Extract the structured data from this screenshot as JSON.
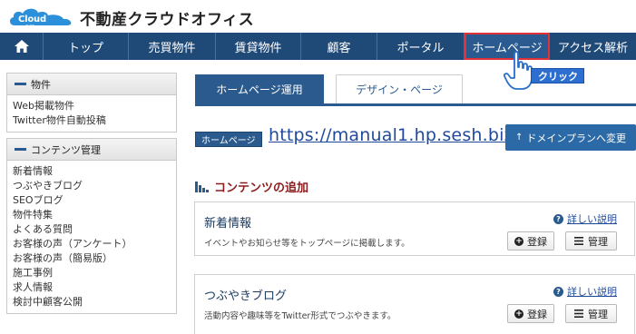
{
  "header": {
    "logo_text": "Cloud office",
    "site_name": "不動産クラウドオフィス"
  },
  "nav": {
    "items": [
      {
        "label": "トップ"
      },
      {
        "label": "売買物件"
      },
      {
        "label": "賃貸物件"
      },
      {
        "label": "顧客"
      },
      {
        "label": "ポータル"
      },
      {
        "label": "ホームページ"
      },
      {
        "label": "アクセス解析"
      }
    ],
    "active": "ホームページ"
  },
  "sidebar": {
    "sections": [
      {
        "title": "物件",
        "links": [
          "Web掲載物件",
          "Twitter物件自動投稿"
        ]
      },
      {
        "title": "コンテンツ管理",
        "links": [
          "新着情報",
          "つぶやきブログ",
          "SEOブログ",
          "物件特集",
          "よくある質問",
          "お客様の声（アンケート）",
          "お客様の声（簡易版）",
          "施工事例",
          "求人情報",
          "検討中顧客公開"
        ]
      }
    ]
  },
  "tabs": [
    {
      "label": "ホームページ運用",
      "active": true
    },
    {
      "label": "デザイン・ページ",
      "active": false
    }
  ],
  "homepage": {
    "badge": "ホームページ",
    "url": "https://manual1.hp.sesh.biz/",
    "domain_button": "ドメインプランへ変更"
  },
  "section_title": "コンテンツの追加",
  "cards": [
    {
      "title": "新着情報",
      "description": "イベントやお知らせ等をトップページに掲載します。",
      "detail_link": "詳しい説明",
      "register_label": "登録",
      "manage_label": "管理"
    },
    {
      "title": "つぶやきブログ",
      "description": "活動内容や趣味等をTwitter形式でつぶやきます。",
      "detail_link": "詳しい説明",
      "register_label": "登録",
      "manage_label": "管理"
    }
  ],
  "callout": {
    "label": "クリック"
  },
  "colors": {
    "nav_bg": "#1f4a78",
    "accent": "#2b5b8e",
    "active_outline": "#e3313a",
    "section_title": "#8c1b1b",
    "link": "#1f4a9c"
  }
}
